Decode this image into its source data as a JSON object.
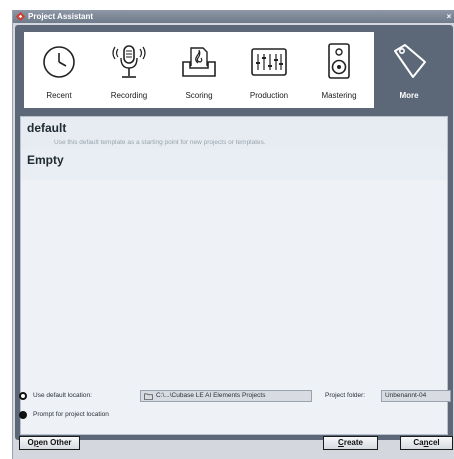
{
  "window": {
    "title": "Project Assistant",
    "close_glyph": "×",
    "logo_icon": "cubase-logo-icon"
  },
  "categories": [
    {
      "label": "Recent",
      "icon": "clock-icon",
      "active": false
    },
    {
      "label": "Recording",
      "icon": "microphone-icon",
      "active": false
    },
    {
      "label": "Scoring",
      "icon": "score-icon",
      "active": false
    },
    {
      "label": "Production",
      "icon": "mixer-icon",
      "active": false
    },
    {
      "label": "Mastering",
      "icon": "speaker-icon",
      "active": false
    },
    {
      "label": "More",
      "icon": "tag-icon",
      "active": true
    }
  ],
  "templates": [
    {
      "name": "default",
      "description": "Use this default template as a starting point for new projects or templates."
    },
    {
      "name": "Empty",
      "description": ""
    }
  ],
  "location": {
    "default_label": "Use default location:",
    "path": "C:\\...\\Cubase LE AI Elements Projects",
    "project_folder_label": "Project folder:",
    "project_folder_value": "Unbenannt-04",
    "prompt_label": "Prompt for project location",
    "selected": "prompt"
  },
  "buttons": {
    "open_other": {
      "mnemonic": "O",
      "rest_pre": "",
      "underline": "p",
      "rest": "en Other"
    },
    "create": {
      "underline": "C",
      "rest": "reate"
    },
    "cancel": {
      "pre": "Ca",
      "underline": "n",
      "rest": "cel"
    }
  },
  "colors": {
    "accent_panel": "#5c6877",
    "active_tab": "#5c6877",
    "logo": "#d23b2a"
  }
}
